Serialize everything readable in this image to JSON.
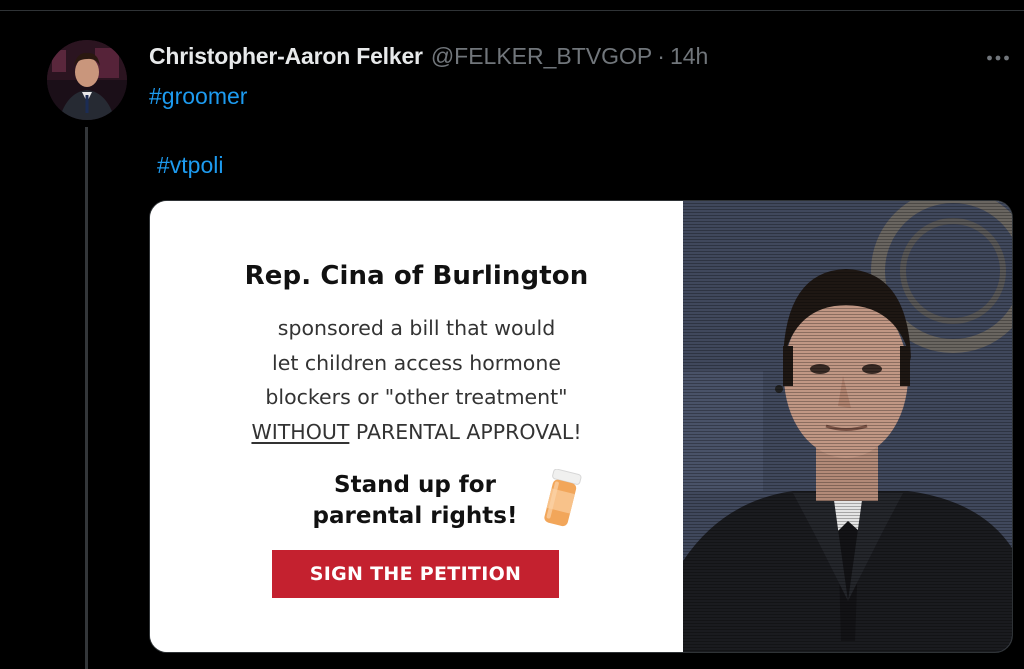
{
  "tweet": {
    "author_name": "Christopher-Aaron Felker",
    "handle": "@FELKER_BTVGOP",
    "separator": "·",
    "time": "14h",
    "hashtags": [
      "#groomer",
      "#vtpoli"
    ]
  },
  "ad": {
    "title": "Rep. Cina of Burlington",
    "body_lines": [
      "sponsored a bill that would",
      "let children access hormone",
      "blockers or \"other treatment\""
    ],
    "emphasis_word": "WITHOUT",
    "emphasis_rest": " PARENTAL APPROVAL!",
    "cta_line1": "Stand up for",
    "cta_line2": "parental rights!",
    "button_label": "SIGN THE PETITION"
  },
  "colors": {
    "link": "#1d9bf0",
    "button": "#c4212f",
    "muted": "#71767b"
  },
  "icons": {
    "more": "more-icon",
    "pill": "pill-bottle-icon"
  }
}
